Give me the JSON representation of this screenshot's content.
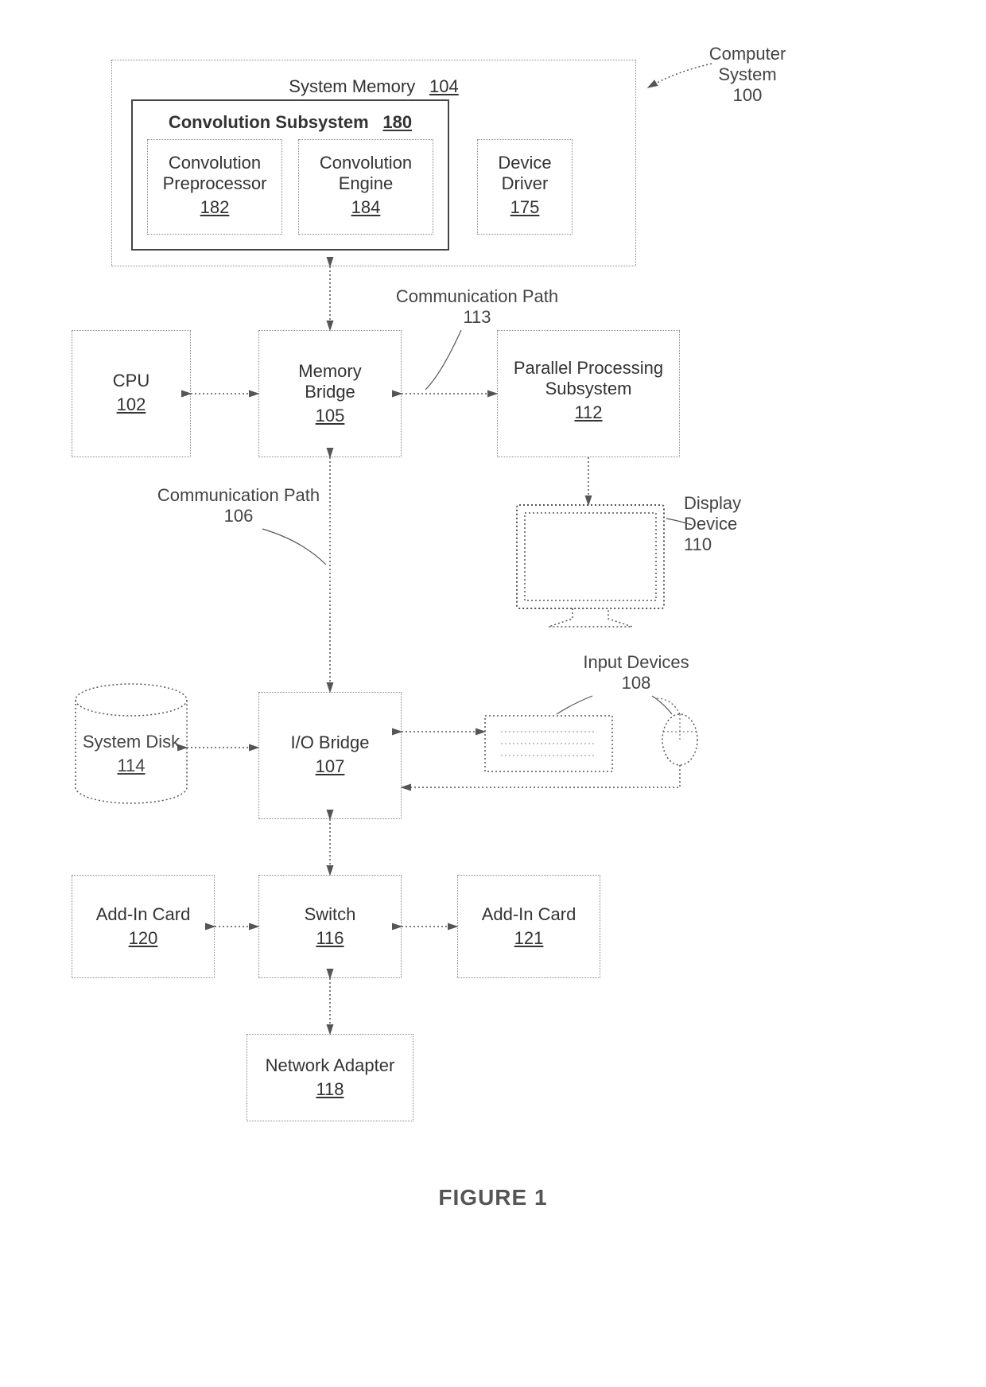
{
  "figure_caption": "FIGURE 1",
  "pointer": {
    "label": "Computer\nSystem",
    "num": "100"
  },
  "sysmem": {
    "title": "System Memory",
    "num": "104"
  },
  "convsub": {
    "title": "Convolution Subsystem",
    "num": "180"
  },
  "convpre": {
    "title": "Convolution\nPreprocessor",
    "num": "182"
  },
  "conveng": {
    "title": "Convolution\nEngine",
    "num": "184"
  },
  "devdrv": {
    "title": "Device\nDriver",
    "num": "175"
  },
  "cpu": {
    "title": "CPU",
    "num": "102"
  },
  "membridge": {
    "title": "Memory\nBridge",
    "num": "105"
  },
  "pps": {
    "title": "Parallel Processing\nSubsystem",
    "num": "112"
  },
  "display": {
    "label": "Display\nDevice",
    "num": "110"
  },
  "commpath1": {
    "label": "Communication Path",
    "num": "113"
  },
  "commpath2": {
    "label": "Communication Path",
    "num": "106"
  },
  "sysdisk": {
    "title": "System Disk",
    "num": "114"
  },
  "iobridge": {
    "title": "I/O Bridge",
    "num": "107"
  },
  "inputdev": {
    "label": "Input Devices",
    "num": "108"
  },
  "addin1": {
    "title": "Add-In Card",
    "num": "120"
  },
  "switch": {
    "title": "Switch",
    "num": "116"
  },
  "addin2": {
    "title": "Add-In Card",
    "num": "121"
  },
  "netadapter": {
    "title": "Network Adapter",
    "num": "118"
  }
}
